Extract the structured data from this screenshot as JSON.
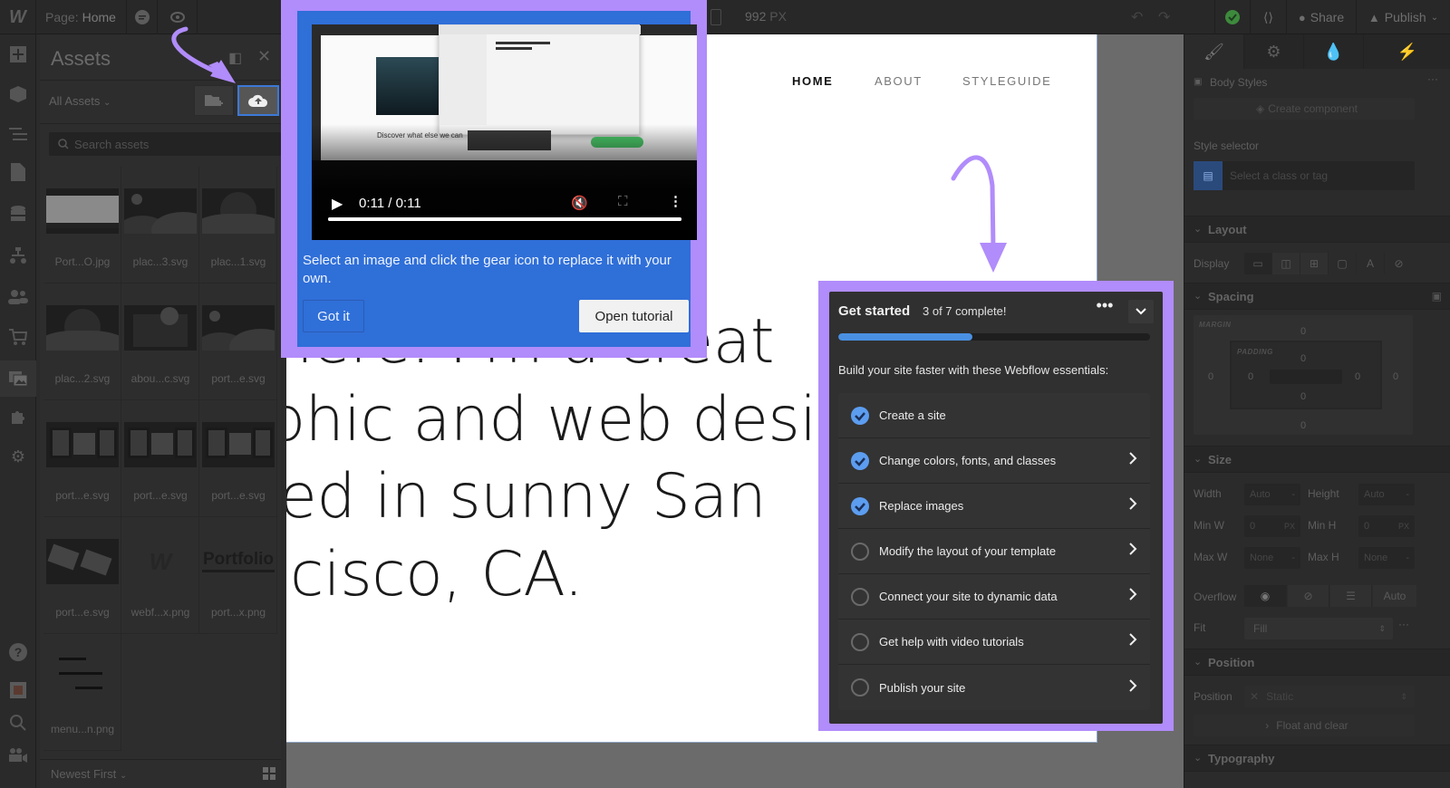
{
  "topbar": {
    "logo": "W",
    "page_label": "Page:",
    "page_name": "Home",
    "canvas_width": "992",
    "canvas_width_unit": "PX",
    "share_label": "Share",
    "publish_label": "Publish"
  },
  "assets": {
    "title": "Assets",
    "filter": "All Assets",
    "search_placeholder": "Search assets",
    "sort": "Newest First",
    "items": [
      {
        "name": "Port...O.jpg",
        "kind": "screenshot"
      },
      {
        "name": "plac...3.svg",
        "kind": "landscape"
      },
      {
        "name": "plac...1.svg",
        "kind": "landscape-sun"
      },
      {
        "name": "plac...2.svg",
        "kind": "landscape-sun"
      },
      {
        "name": "abou...c.svg",
        "kind": "illustration"
      },
      {
        "name": "port...e.svg",
        "kind": "landscape"
      },
      {
        "name": "port...e.svg",
        "kind": "frames"
      },
      {
        "name": "port...e.svg",
        "kind": "frames"
      },
      {
        "name": "port...e.svg",
        "kind": "frames"
      },
      {
        "name": "port...e.svg",
        "kind": "tiles"
      },
      {
        "name": "webf...x.png",
        "kind": "logo",
        "glyph": "W"
      },
      {
        "name": "port...x.png",
        "kind": "wordmark",
        "glyph": "Portfolio"
      },
      {
        "name": "menu...n.png",
        "kind": "menu"
      }
    ]
  },
  "canvas": {
    "nav": [
      "HOME",
      "ABOUT",
      "STYLEGUIDE"
    ],
    "hero_lines": [
      "there. I'm a creat",
      "phic and web desi",
      "ed in sunny San",
      "cisco, CA."
    ]
  },
  "tooltip": {
    "video_time": "0:11 / 0:11",
    "video_progress": 1.0,
    "video_preview_heading": "Discover what else we can",
    "text": "Select an image and click the gear icon to replace it with your own.",
    "got_it": "Got it",
    "open_tutorial": "Open tutorial"
  },
  "get_started": {
    "title": "Get started",
    "count": "3 of 7 complete!",
    "progress": 0.43,
    "subtitle": "Build your site faster with these Webflow essentials:",
    "items": [
      {
        "label": "Create a site",
        "done": true,
        "chevron": false
      },
      {
        "label": "Change colors, fonts, and classes",
        "done": true,
        "chevron": true
      },
      {
        "label": "Replace images",
        "done": true,
        "chevron": true
      },
      {
        "label": "Modify the layout of your template",
        "done": false,
        "chevron": true
      },
      {
        "label": "Connect your site to dynamic data",
        "done": false,
        "chevron": true
      },
      {
        "label": "Get help with video tutorials",
        "done": false,
        "chevron": true
      },
      {
        "label": "Publish your site",
        "done": false,
        "chevron": true
      }
    ]
  },
  "style_panel": {
    "body_styles": "Body Styles",
    "create_component": "Create component",
    "style_selector_label": "Style selector",
    "selector_placeholder": "Select a class or tag",
    "layout": "Layout",
    "display_label": "Display",
    "spacing": "Spacing",
    "margin_label": "MARGIN",
    "padding_label": "PADDING",
    "margin": {
      "top": "0",
      "right": "0",
      "bottom": "0",
      "left": "0"
    },
    "padding": {
      "top": "0",
      "right": "0",
      "bottom": "0",
      "left": "0"
    },
    "size": "Size",
    "width_label": "Width",
    "width_value": "Auto",
    "height_label": "Height",
    "height_value": "Auto",
    "min_w_label": "Min W",
    "min_w_value": "0",
    "min_w_unit": "PX",
    "min_h_label": "Min H",
    "min_h_value": "0",
    "min_h_unit": "PX",
    "max_w_label": "Max W",
    "max_w_value": "None",
    "max_h_label": "Max H",
    "max_h_value": "None",
    "overflow_label": "Overflow",
    "overflow_auto": "Auto",
    "fit_label": "Fit",
    "fit_value": "Fill",
    "position_section": "Position",
    "position_label": "Position",
    "position_value": "Static",
    "float_clear": "Float and clear",
    "typography": "Typography"
  },
  "colors": {
    "highlight": "#b18cfb",
    "tooltip_blue": "#2f6fd8",
    "progress_blue": "#4a90e2",
    "check_blue": "#5c9df0"
  }
}
